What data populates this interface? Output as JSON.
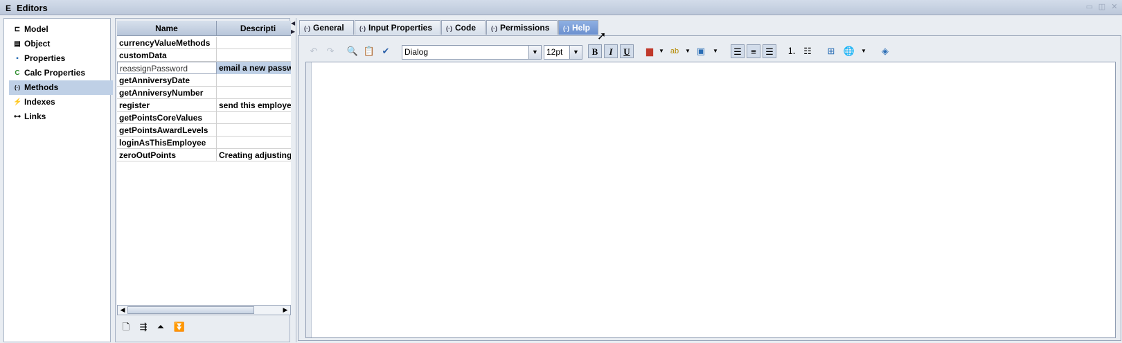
{
  "window": {
    "app_icon": "E",
    "title": "Editors"
  },
  "nav": {
    "items": [
      {
        "label": "Model",
        "icon": "model-icon",
        "glyph": "⊏"
      },
      {
        "label": "Object",
        "icon": "object-icon",
        "glyph": "▤"
      },
      {
        "label": "Properties",
        "icon": "properties-icon",
        "glyph": "▪"
      },
      {
        "label": "Calc Properties",
        "icon": "calc-properties-icon",
        "glyph": "C"
      },
      {
        "label": "Methods",
        "icon": "methods-icon",
        "glyph": "(·)",
        "active": true
      },
      {
        "label": "Indexes",
        "icon": "indexes-icon",
        "glyph": "⚡"
      },
      {
        "label": "Links",
        "icon": "links-icon",
        "glyph": "⊶"
      }
    ]
  },
  "methods_table": {
    "columns": [
      "Name",
      "Descripti"
    ],
    "rows": [
      {
        "name": "currencyValueMethods",
        "description": ""
      },
      {
        "name": "customData",
        "description": ""
      },
      {
        "name": "reassignPassword",
        "description": "email a new passw",
        "selected": true
      },
      {
        "name": "getAnniversyDate",
        "description": ""
      },
      {
        "name": "getAnniversyNumber",
        "description": ""
      },
      {
        "name": "register",
        "description": "send this employe"
      },
      {
        "name": "getPointsCoreValues",
        "description": ""
      },
      {
        "name": "getPointsAwardLevels",
        "description": ""
      },
      {
        "name": "loginAsThisEmployee",
        "description": ""
      },
      {
        "name": "zeroOutPoints",
        "description": "Creating adjusting"
      }
    ]
  },
  "tabs": [
    {
      "label": "General"
    },
    {
      "label": "Input Properties"
    },
    {
      "label": "Code"
    },
    {
      "label": "Permissions"
    },
    {
      "label": "Help",
      "active": true
    }
  ],
  "toolbar": {
    "font": "Dialog",
    "size": "12pt"
  }
}
